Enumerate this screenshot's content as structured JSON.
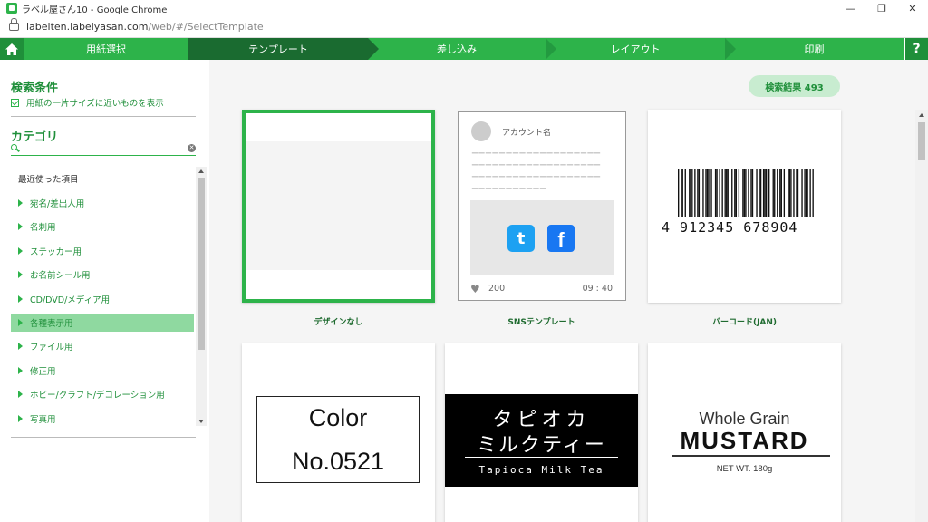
{
  "browser": {
    "title": "ラベル屋さん10 - Google Chrome",
    "url_host": "labelten.labelyasan.com",
    "url_path": "/web/#/SelectTemplate"
  },
  "steps": [
    {
      "label": "用紙選択",
      "active": false
    },
    {
      "label": "テンプレート",
      "active": true
    },
    {
      "label": "差し込み",
      "active": false
    },
    {
      "label": "レイアウト",
      "active": false
    },
    {
      "label": "印刷",
      "active": false
    }
  ],
  "help_label": "?",
  "sidebar": {
    "search_conditions_title": "検索条件",
    "checkbox_label": "用紙の一片サイズに近いものを表示",
    "category_title": "カテゴリ",
    "search_placeholder": "",
    "categories": [
      {
        "label": "最近使った項目",
        "expandable": false,
        "selected": false
      },
      {
        "label": "宛名/差出人用",
        "expandable": true,
        "selected": false
      },
      {
        "label": "名刺用",
        "expandable": true,
        "selected": false
      },
      {
        "label": "ステッカー用",
        "expandable": true,
        "selected": false
      },
      {
        "label": "お名前シール用",
        "expandable": true,
        "selected": false
      },
      {
        "label": "CD/DVD/メディア用",
        "expandable": true,
        "selected": false
      },
      {
        "label": "各種表示用",
        "expandable": true,
        "selected": true
      },
      {
        "label": "ファイル用",
        "expandable": true,
        "selected": false
      },
      {
        "label": "修正用",
        "expandable": true,
        "selected": false
      },
      {
        "label": "ホビー/クラフト/デコレーション用",
        "expandable": true,
        "selected": false
      },
      {
        "label": "写真用",
        "expandable": true,
        "selected": false
      }
    ]
  },
  "results": {
    "label": "検索結果 493"
  },
  "templates": [
    {
      "label": "デザインなし"
    },
    {
      "label": "SNSテンプレート"
    },
    {
      "label": "バーコード(JAN)"
    }
  ],
  "sns": {
    "account": "アカウント名",
    "dashes": "ーーーーーーーーーーーーーーーーーーー",
    "dashes_short": "ーーーーーーーーーーー",
    "likes": "200",
    "time": "09 : 40",
    "twitter_glyph": "t",
    "facebook_glyph": "f"
  },
  "barcode": {
    "digits": "4 912345 678904"
  },
  "color_template": {
    "line1": "Color",
    "line2": "No.0521"
  },
  "tapioca_template": {
    "line1": "タピオカ",
    "line2": "ミルクティー",
    "line3": "Tapioca Milk Tea"
  },
  "mustard_template": {
    "line1": "Whole Grain",
    "line2": "MUSTARD",
    "line3": "NET WT. 180g"
  },
  "colors": {
    "brand_green": "#2db34a",
    "active_step": "#1a6b30",
    "selected_category": "#8fd9a0"
  }
}
